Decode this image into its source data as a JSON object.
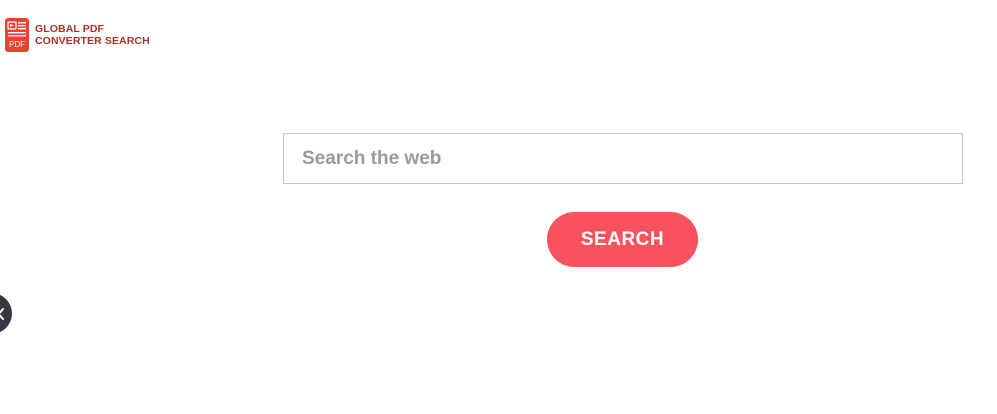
{
  "brand": {
    "line1": "GLOBAL PDF",
    "line2": "CONVERTER SEARCH",
    "icon_label": "PDF",
    "icon": "pdf-file-icon",
    "color": "#b03025"
  },
  "search": {
    "placeholder": "Search the web",
    "value": "",
    "button_label": "SEARCH",
    "button_color": "#f9525f"
  },
  "side_toggle": {
    "icon": "chevron-left-icon",
    "color": "#3a3640"
  }
}
